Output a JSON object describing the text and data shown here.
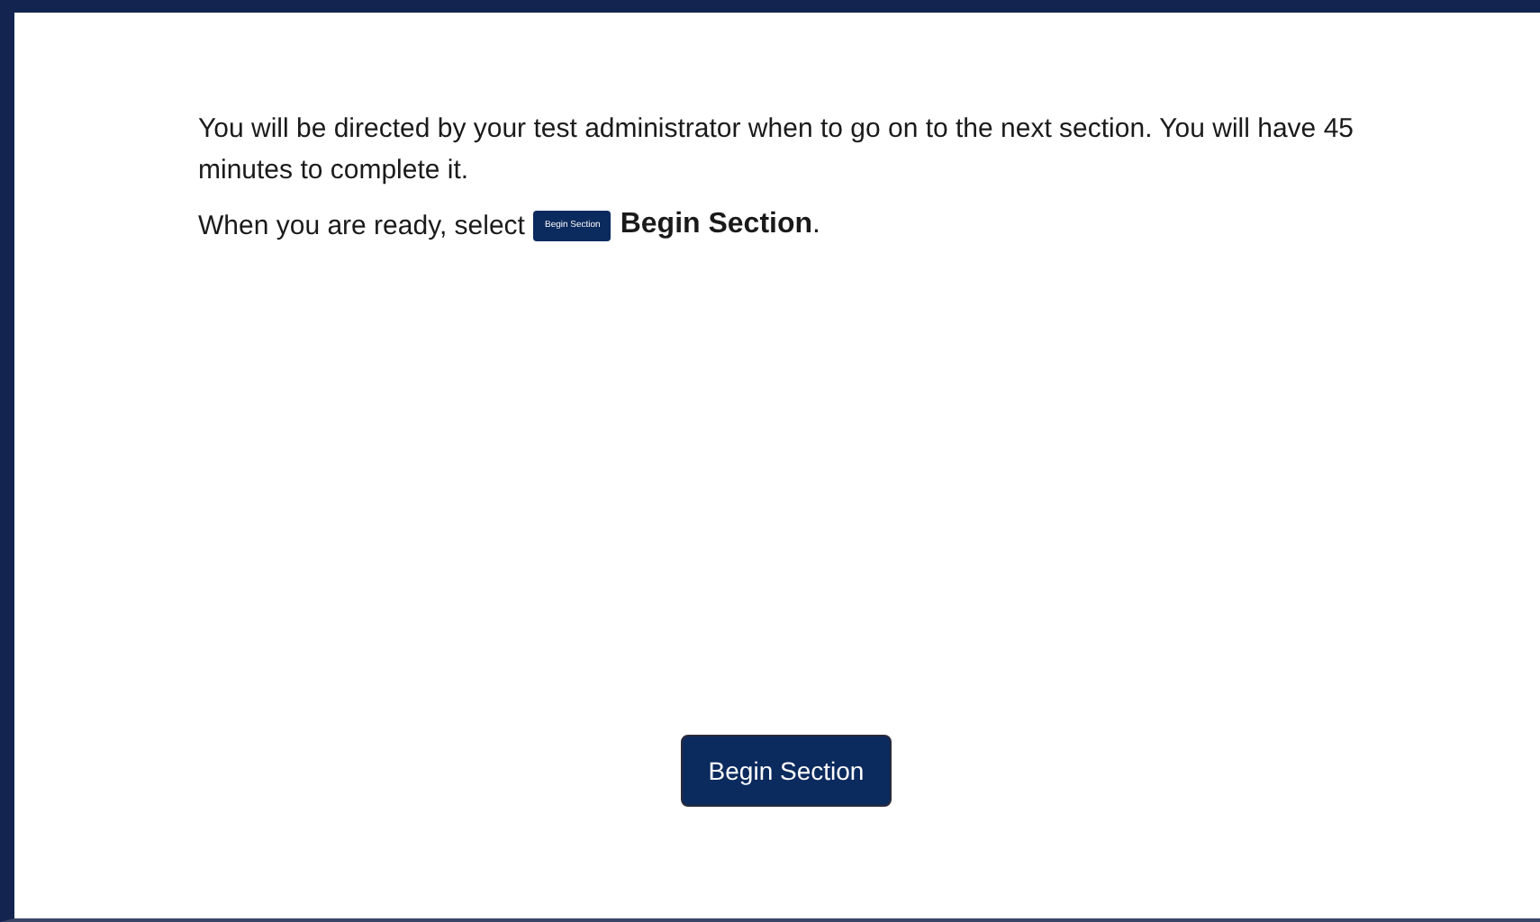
{
  "instructions": {
    "paragraph": "You will be directed by your test administrator when to go on to the next section. You will have 45 minutes to complete it.",
    "ready_prompt": {
      "lead": "When you are ready, select",
      "inline_button": "Begin Section",
      "tail": "**Begin Section**."
    }
  },
  "begin_button": {
    "label": "Begin Section"
  }
}
